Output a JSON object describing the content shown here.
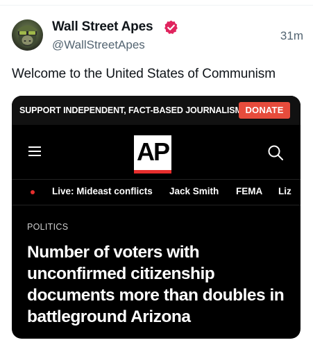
{
  "post": {
    "display_name": "Wall Street Apes",
    "handle": "@WallStreetApes",
    "timestamp": "31m",
    "text": "Welcome to the United States of Communism",
    "verified_color": "#e0245e"
  },
  "media": {
    "support_text": "SUPPORT INDEPENDENT, FACT-BASED JOURNALISM.",
    "donate_label": "DONATE",
    "logo_text": "AP",
    "topics": [
      "Live: Mideast conflicts",
      "Jack Smith",
      "FEMA",
      "Liz"
    ],
    "section": "POLITICS",
    "headline": "Number of voters with unconfirmed citizenship documents more than doubles in battleground Arizona",
    "accent_color": "#e62e2d"
  }
}
